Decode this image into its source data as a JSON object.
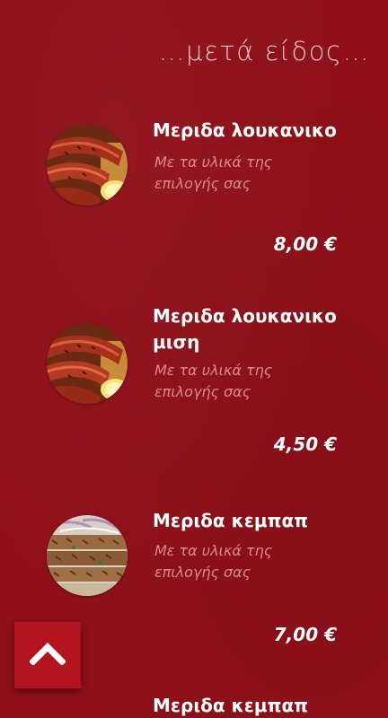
{
  "section": {
    "title": "…μετά είδος…"
  },
  "items": [
    {
      "name": "Μεριδα λουκανικο",
      "description": "Με τα υλικά της επιλογής σας",
      "price": "8,00 €",
      "image_icon": "sausage-plate-icon"
    },
    {
      "name": "Μεριδα λουκανικο μιση",
      "description": "Με τα υλικά της επιλογής σας",
      "price": "4,50 €",
      "image_icon": "sausage-plate-icon"
    },
    {
      "name": "Μεριδα κεμπαπ",
      "description": "Με τα υλικά της επιλογής σας",
      "price": "7,00 €",
      "image_icon": "kebab-plate-icon"
    },
    {
      "name": "Μεριδα κεμπαπ"
    }
  ],
  "scroll_top": {
    "icon": "chevron-up-icon"
  },
  "colors": {
    "background": "#8f1019",
    "description_text": "#d88a8f",
    "scroll_button": "#b3131e"
  }
}
